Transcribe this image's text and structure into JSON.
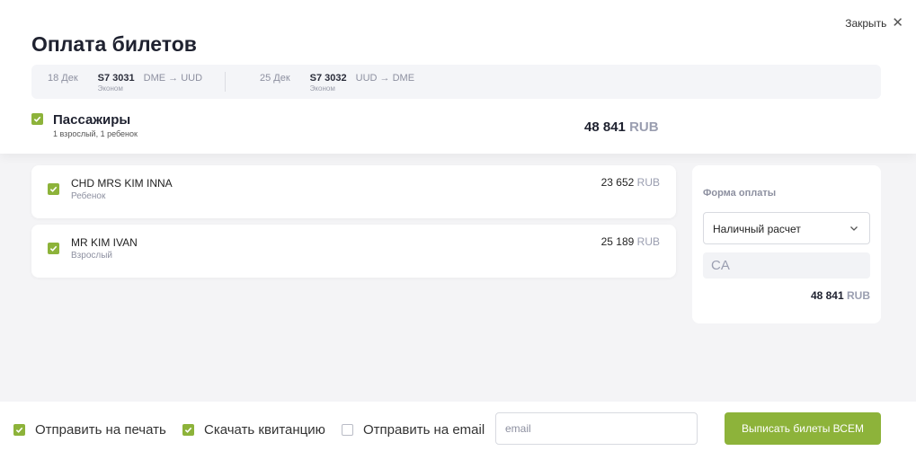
{
  "header": {
    "close_label": "Закрыть",
    "title": "Оплата билетов"
  },
  "flights": [
    {
      "date": "18 Дек",
      "number": "S7 3031",
      "class": "Эконом",
      "route": "DME → UUD"
    },
    {
      "date": "25 Дек",
      "number": "S7 3032",
      "class": "Эконом",
      "route": "UUD → DME"
    }
  ],
  "passengers_section": {
    "label": "Пассажиры",
    "summary": "1 взрослый, 1 ребенок",
    "total_amount": "48 841",
    "currency": "RUB",
    "checked": true
  },
  "passengers": [
    {
      "name": "CHD MRS KIM INNA",
      "type": "Ребенок",
      "amount": "23 652",
      "currency": "RUB",
      "checked": true
    },
    {
      "name": "MR KIM IVAN",
      "type": "Взрослый",
      "amount": "25 189",
      "currency": "RUB",
      "checked": true
    }
  ],
  "payment": {
    "title": "Форма оплаты",
    "selected_method": "Наличный расчет",
    "code": "CA",
    "total_amount": "48 841",
    "currency": "RUB"
  },
  "footer": {
    "print_label": "Отправить на печать",
    "print_checked": true,
    "receipt_label": "Скачать квитанцию",
    "receipt_checked": true,
    "email_label": "Отправить на email",
    "email_checked": false,
    "email_placeholder": "email",
    "issue_button_label": "Выписать билеты ВСЕМ"
  },
  "colors": {
    "accent": "#8db33a",
    "background": "#f4f4f6",
    "muted_text": "#9a9eb0"
  }
}
